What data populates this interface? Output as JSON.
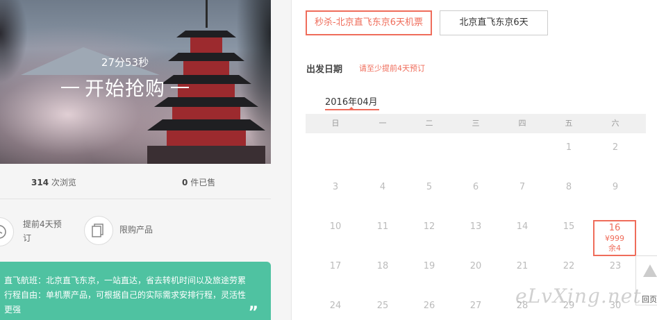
{
  "hero": {
    "countdown": "27分53秒",
    "start_label": "开始抢购"
  },
  "stats": {
    "views_count": "314",
    "views_label": "次浏览",
    "sold_count": "0",
    "sold_label": "件已售"
  },
  "features": [
    {
      "icon": "clock-icon",
      "label_line1": "提前4天预",
      "label_line2": "订"
    },
    {
      "icon": "copy-icon",
      "label_line1": "限购产品"
    }
  ],
  "promo": {
    "line1": "直飞航班：北京直飞东京，一站直达，省去转机时间以及旅途劳累",
    "line2": "行程自由：单机票产品，可根据自己的实际需求安排行程，灵活性",
    "line3": "更强",
    "quote_mark": "”"
  },
  "tabs": [
    {
      "label": "秒杀-北京直飞东京6天机票",
      "active": true
    },
    {
      "label": "北京直飞东京6天",
      "active": false
    }
  ],
  "departure": {
    "label": "出发日期",
    "note": "请至少提前4天预订"
  },
  "calendar": {
    "month": "2016年04月",
    "weekdays": [
      "日",
      "一",
      "二",
      "三",
      "四",
      "五",
      "六"
    ],
    "days": [
      [
        "",
        "",
        "",
        "",
        "",
        "1",
        "2"
      ],
      [
        "3",
        "4",
        "5",
        "6",
        "7",
        "8",
        "9"
      ],
      [
        "10",
        "11",
        "12",
        "13",
        "14",
        "15",
        "16"
      ],
      [
        "17",
        "18",
        "19",
        "20",
        "21",
        "22",
        "23"
      ],
      [
        "24",
        "25",
        "26",
        "27",
        "28",
        "29",
        "30"
      ]
    ],
    "selected": {
      "day": "16",
      "price": "¥999",
      "remaining": "余4"
    }
  },
  "back_to_top": "回页",
  "watermark": "eLvXing.net",
  "colors": {
    "accent": "#ef6c5a",
    "promo_bg": "#4fc2a1"
  }
}
